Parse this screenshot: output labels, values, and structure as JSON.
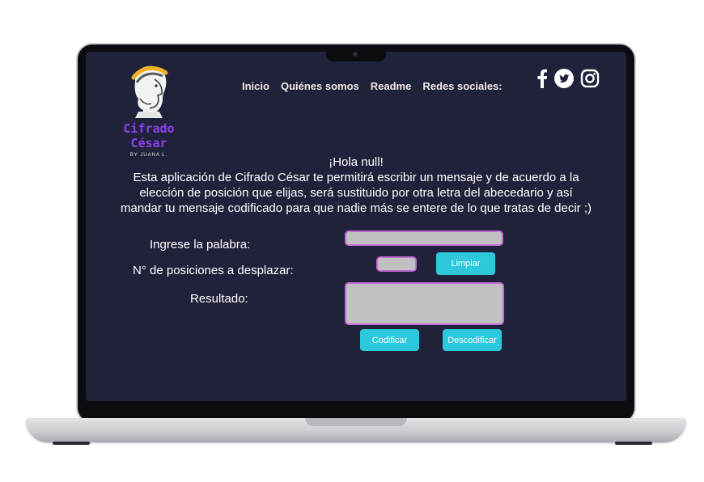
{
  "app": {
    "logo_title": "Cifrado César",
    "logo_subtitle": "BY JUANA L."
  },
  "nav": {
    "items": [
      "Inicio",
      "Quiénes somos",
      "Readme",
      "Redes sociales:"
    ]
  },
  "social": [
    "facebook-icon",
    "twitter-icon",
    "instagram-icon"
  ],
  "intro": {
    "greeting": "¡Hola null!",
    "line1": "Esta aplicación de Cifrado César te permitirá escribir un mensaje y de acuerdo a la",
    "line2": "elección de posición que elijas, será sustituido por otra letra del abecedario y así",
    "line3": "mandar tu mensaje codificado  para que nadie más se entere de lo que tratas de decir ;)"
  },
  "form": {
    "word_label": "Ingrese la palabra:",
    "word_value": "",
    "offset_label": "N° de posiciones a desplazar:",
    "offset_value": "",
    "result_label": "Resultado:",
    "result_value": ""
  },
  "buttons": {
    "clear": "Limpiar",
    "encode": "Codificar",
    "decode": "Descodificar"
  },
  "colors": {
    "screen_bg": "#20213b",
    "accent_button": "#2cc9dc",
    "input_border": "#c46bd6",
    "logo_purple": "#8a3ff0"
  }
}
